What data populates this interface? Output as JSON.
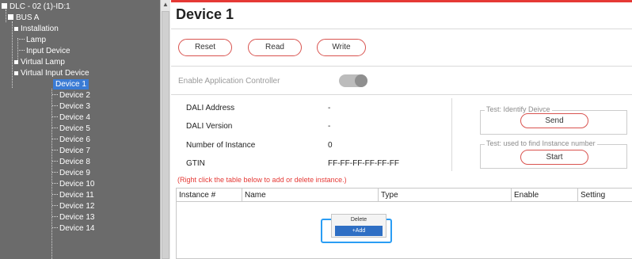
{
  "sidebar": {
    "root": "DLC - 02 (1)-ID:1",
    "bus": "BUS A",
    "installation": "Installation",
    "lamp": "Lamp",
    "input_device": "Input Device",
    "virtual_lamp": "Virtual Lamp",
    "virtual_input_device": "Virtual Input Device",
    "devices": [
      "Device 1",
      "Device 2",
      "Device 3",
      "Device 4",
      "Device 5",
      "Device 6",
      "Device 7",
      "Device 8",
      "Device 9",
      "Device 10",
      "Device 11",
      "Device 12",
      "Device 13",
      "Device 14"
    ]
  },
  "header": {
    "title": "Device 1"
  },
  "toolbar": {
    "reset": "Reset",
    "read": "Read",
    "write": "Write"
  },
  "enable": {
    "label": "Enable Application Controller",
    "on": false
  },
  "info": {
    "dali_address_label": "DALI Address",
    "dali_address_value": "-",
    "dali_version_label": "DALI Version",
    "dali_version_value": "-",
    "instances_label": "Number of Instance",
    "instances_value": "0",
    "gtin_label": "GTIN",
    "gtin_value": "FF-FF-FF-FF-FF-FF"
  },
  "identify": {
    "title": "Test: Identify Deivce",
    "button": "Send"
  },
  "find_instance": {
    "title": "Test: used to find Instance number",
    "button": "Start"
  },
  "hint": "(Right click the table below to add or delete instance.)",
  "table": {
    "columns": [
      "Instance #",
      "Name",
      "Type",
      "Enable",
      "Setting"
    ]
  },
  "context_menu": {
    "delete": "Delete",
    "add": "+Add"
  },
  "colors": {
    "accent_red": "#e53935",
    "selection_blue": "#3a7bd5",
    "sidebar_bg": "#6b6b6b"
  }
}
